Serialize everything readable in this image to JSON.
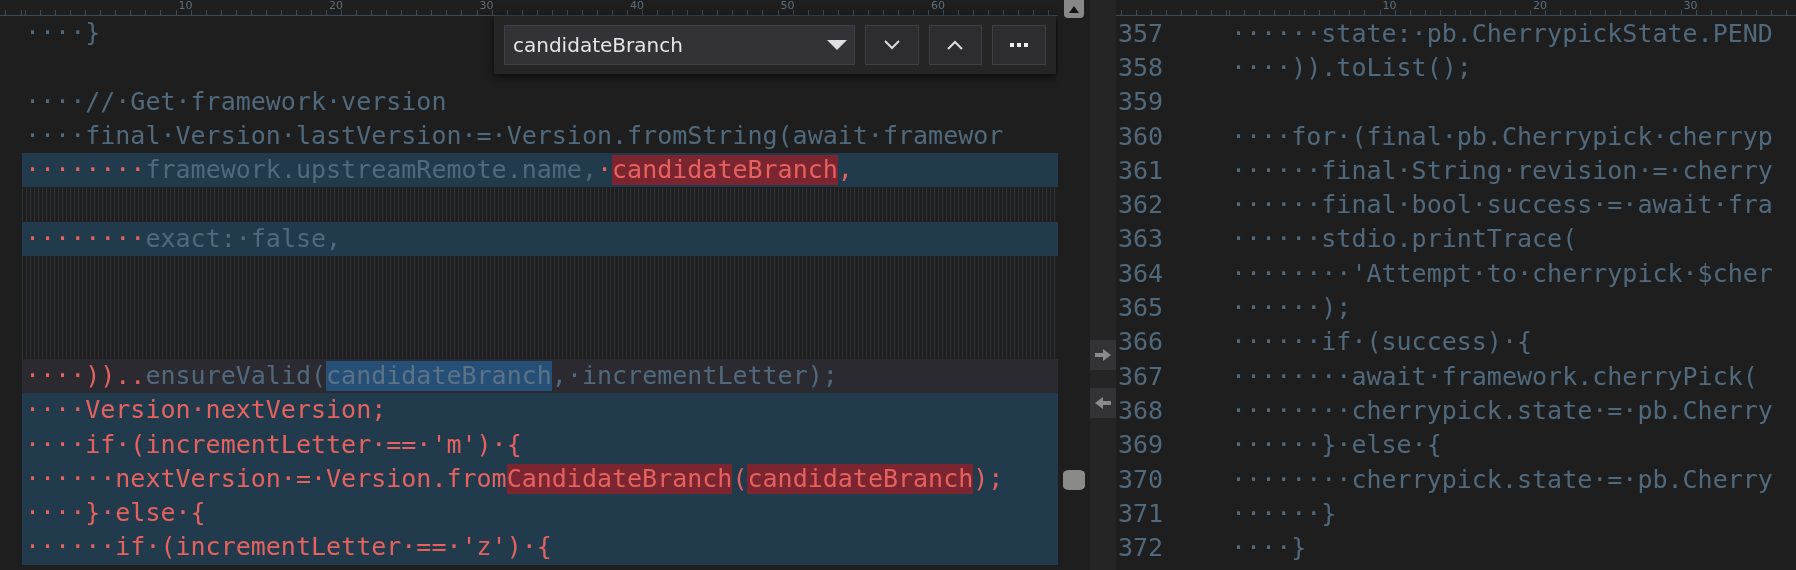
{
  "find_widget": {
    "value": "candidateBranch"
  },
  "left_pane": {
    "ruler": [
      "10",
      "20",
      "30",
      "40",
      "50",
      "60"
    ],
    "lines": [
      {
        "kind": "context",
        "segments": [
          {
            "kind": "plain",
            "text": "····}"
          }
        ]
      },
      {
        "kind": "context"
      },
      {
        "kind": "context",
        "segments": [
          {
            "kind": "plain",
            "text": "····//·Get·framework·version"
          }
        ]
      },
      {
        "kind": "context",
        "segments": [
          {
            "kind": "plain",
            "text": "····final·Version·lastVersion·=·Version.fromString(await·framewor"
          }
        ]
      },
      {
        "kind": "added",
        "segments": [
          {
            "kind": "removed",
            "text": "········"
          },
          {
            "kind": "plain",
            "text": "framework.upstreamRemote.name,"
          },
          {
            "kind": "removed",
            "text": "·"
          },
          {
            "kind": "diff",
            "text": "candidateBranch"
          },
          {
            "kind": "removed",
            "text": ","
          }
        ]
      },
      {
        "kind": "filler"
      },
      {
        "kind": "added",
        "segments": [
          {
            "kind": "removed",
            "text": "········"
          },
          {
            "kind": "plain",
            "text": "exact:·false,"
          }
        ]
      },
      {
        "kind": "filler"
      },
      {
        "kind": "filler"
      },
      {
        "kind": "filler"
      },
      {
        "kind": "current",
        "segments": [
          {
            "kind": "removed",
            "text": "····)).."
          },
          {
            "kind": "plain",
            "text": "ensureValid("
          },
          {
            "kind": "match",
            "text": "candidateBranch"
          },
          {
            "kind": "plain",
            "text": ",·incrementLetter);"
          }
        ]
      },
      {
        "kind": "added",
        "segments": [
          {
            "kind": "removed",
            "text": "····Version·nextVersion;"
          }
        ]
      },
      {
        "kind": "added",
        "segments": [
          {
            "kind": "removed",
            "text": "····if·(incrementLetter·==·'m')·{"
          }
        ]
      },
      {
        "kind": "added",
        "segments": [
          {
            "kind": "removed",
            "text": "······nextVersion·=·Version.from"
          },
          {
            "kind": "diff",
            "text": "CandidateBranch"
          },
          {
            "kind": "removed",
            "text": "("
          },
          {
            "kind": "diff",
            "text": "candidateBranch"
          },
          {
            "kind": "removed",
            "text": ");"
          }
        ]
      },
      {
        "kind": "added",
        "segments": [
          {
            "kind": "removed",
            "text": "····}·else·{"
          }
        ]
      },
      {
        "kind": "added",
        "segments": [
          {
            "kind": "removed",
            "text": "······if·(incrementLetter·==·'z')·{"
          }
        ]
      }
    ]
  },
  "right_pane": {
    "ruler": [
      "10",
      "20",
      "30"
    ],
    "lines": [
      {
        "number": "357",
        "text": "······state:·pb.CherrypickState.PEND"
      },
      {
        "number": "358",
        "text": "····)).toList();"
      },
      {
        "number": "359"
      },
      {
        "number": "360",
        "text": "····for·(final·pb.Cherrypick·cherryp"
      },
      {
        "number": "361",
        "text": "······final·String·revision·=·cherry"
      },
      {
        "number": "362",
        "text": "······final·bool·success·=·await·fra"
      },
      {
        "number": "363",
        "text": "······stdio.printTrace("
      },
      {
        "number": "364",
        "text": "········'Attempt·to·cherrypick·$cher"
      },
      {
        "number": "365",
        "text": "······);"
      },
      {
        "number": "366",
        "text": "······if·(success)·{"
      },
      {
        "number": "367",
        "text": "········await·framework.cherryPick("
      },
      {
        "number": "368",
        "text": "········cherrypick.state·=·pb.Cherry"
      },
      {
        "number": "369",
        "text": "······}·else·{"
      },
      {
        "number": "370",
        "text": "········cherrypick.state·=·pb.Cherry"
      },
      {
        "number": "371",
        "text": "······}"
      },
      {
        "number": "372",
        "text": "····}"
      }
    ]
  }
}
